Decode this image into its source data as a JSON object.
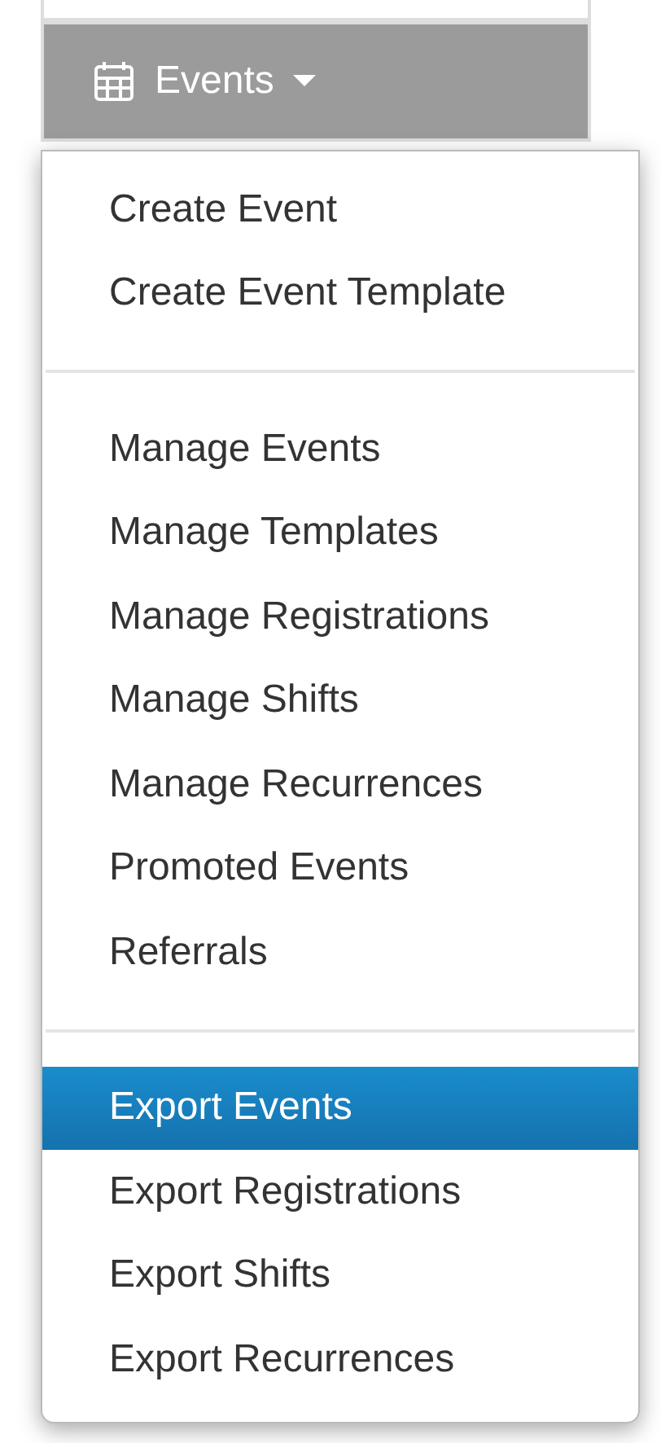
{
  "menu_button": {
    "label": "Events",
    "expanded": true
  },
  "menu": {
    "sections": [
      {
        "items": [
          {
            "label": "Create Event",
            "selected": false
          },
          {
            "label": "Create Event Template",
            "selected": false
          }
        ]
      },
      {
        "items": [
          {
            "label": "Manage Events",
            "selected": false
          },
          {
            "label": "Manage Templates",
            "selected": false
          },
          {
            "label": "Manage Registrations",
            "selected": false
          },
          {
            "label": "Manage Shifts",
            "selected": false
          },
          {
            "label": "Manage Recurrences",
            "selected": false
          },
          {
            "label": "Promoted Events",
            "selected": false
          },
          {
            "label": "Referrals",
            "selected": false
          }
        ]
      },
      {
        "items": [
          {
            "label": "Export Events",
            "selected": true
          },
          {
            "label": "Export Registrations",
            "selected": false
          },
          {
            "label": "Export Shifts",
            "selected": false
          },
          {
            "label": "Export Recurrences",
            "selected": false
          }
        ]
      }
    ]
  }
}
